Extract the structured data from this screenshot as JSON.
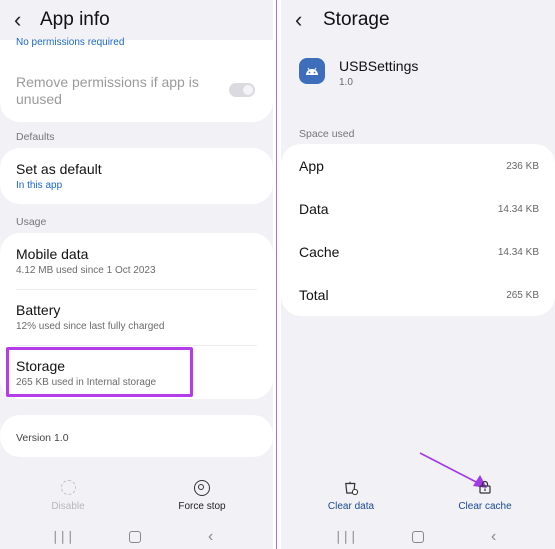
{
  "left": {
    "title": "App info",
    "clipped_text": "No permissions required",
    "remove_permissions_label": "Remove permissions if app is unused",
    "defaults_section": "Defaults",
    "set_default_title": "Set as default",
    "set_default_sub": "In this app",
    "usage_section": "Usage",
    "mobile_data_title": "Mobile data",
    "mobile_data_sub": "4.12 MB used since 1 Oct 2023",
    "battery_title": "Battery",
    "battery_sub": "12% used since last fully charged",
    "storage_title": "Storage",
    "storage_sub": "265 KB used in Internal storage",
    "version": "Version 1.0",
    "disable_label": "Disable",
    "force_stop_label": "Force stop"
  },
  "right": {
    "title": "Storage",
    "app_name": "USBSettings",
    "app_version": "1.0",
    "space_used_section": "Space used",
    "rows": [
      {
        "label": "App",
        "value": "236 KB"
      },
      {
        "label": "Data",
        "value": "14.34 KB"
      },
      {
        "label": "Cache",
        "value": "14.34 KB"
      },
      {
        "label": "Total",
        "value": "265 KB"
      }
    ],
    "clear_data_label": "Clear data",
    "clear_cache_label": "Clear cache"
  },
  "colors": {
    "accent": "#1a66c9",
    "highlight": "#b53ce8",
    "arrow": "#a23be6",
    "background": "#f1f1f6"
  }
}
